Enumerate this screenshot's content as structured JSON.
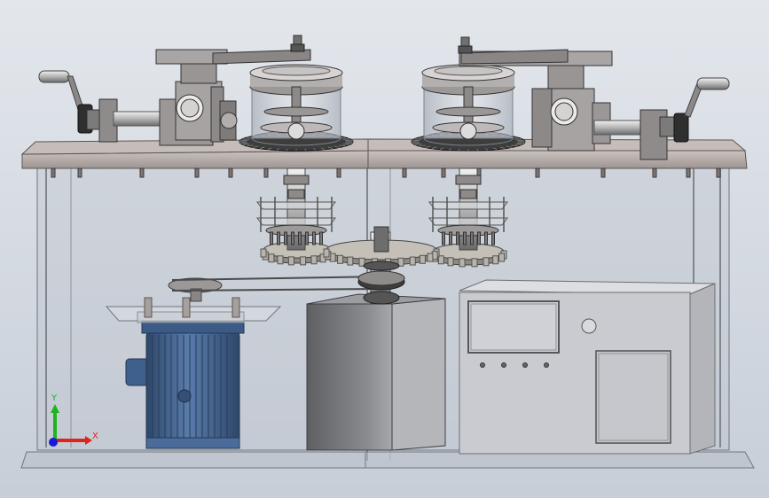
{
  "viewport": {
    "background_top": "#e3e7ec",
    "background_bottom": "#c7ced8"
  },
  "colors": {
    "frame_glass": "#b9c0c9",
    "frame_edge": "#6f757c",
    "plate": "#b7aeaa",
    "plate_edge": "#5b5553",
    "steel": "#9a9696",
    "steel_dark": "#585454",
    "disc_dark": "#3d3d3d",
    "cylinder_glass": "#c9ced6",
    "motor_blue": "#4d6f9e",
    "motor_blue_dark": "#2e4769",
    "gearbox_gray": "#7b7c80",
    "cabinet": "#c9cbd0",
    "cabinet_edge": "#6e6f73",
    "gear_light": "#c4c0b7",
    "triad_x": "#e0231b",
    "triad_y": "#1db41d",
    "triad_z": "#1a1ad6"
  },
  "triad": {
    "x_label": "X",
    "y_label": "Y"
  },
  "icons": [
    "left-crank-handle-icon",
    "right-crank-handle-icon",
    "motor-icon",
    "gearbox-icon",
    "control-cabinet-icon",
    "coordinate-triad-icon"
  ]
}
